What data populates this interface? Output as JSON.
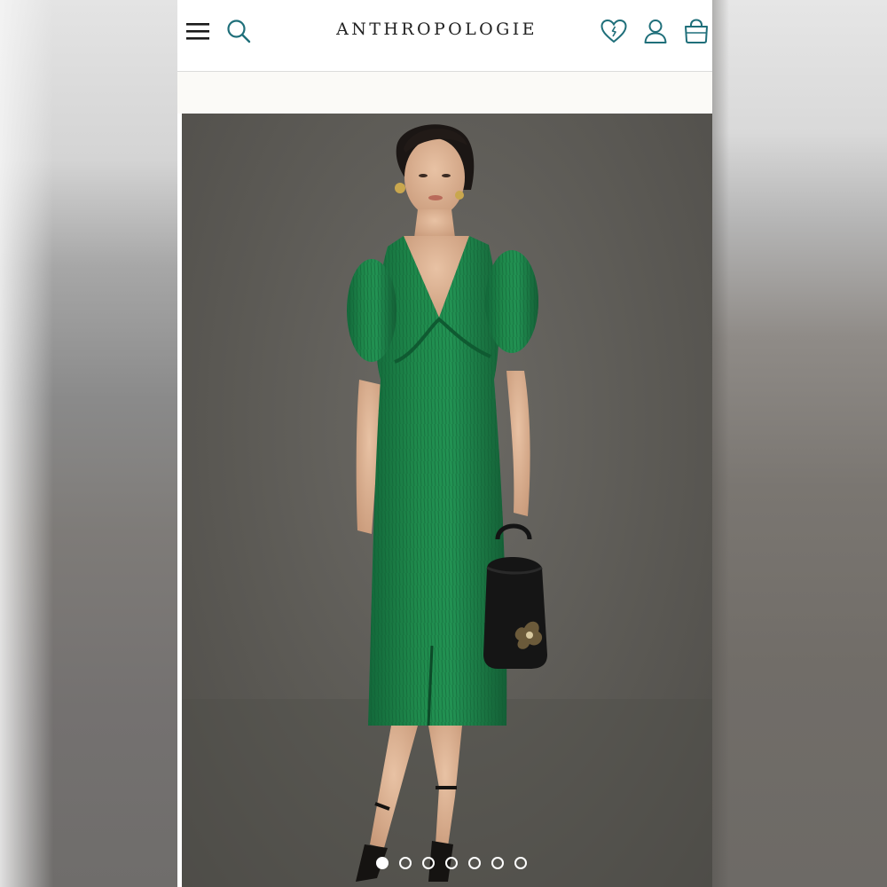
{
  "header": {
    "brand": "ANTHROPOLOGIE",
    "icons": {
      "menu": "hamburger-menu-icon",
      "search": "search-icon",
      "wishlist": "heart-icon",
      "account": "user-icon",
      "cart": "shopping-bag-icon"
    },
    "icon_color": "#1f6f7a"
  },
  "product": {
    "image": "green-plisse-midi-dress-photo",
    "dress_color": "#1f8a4c",
    "carousel": {
      "total": 7,
      "active_index": 0
    }
  }
}
